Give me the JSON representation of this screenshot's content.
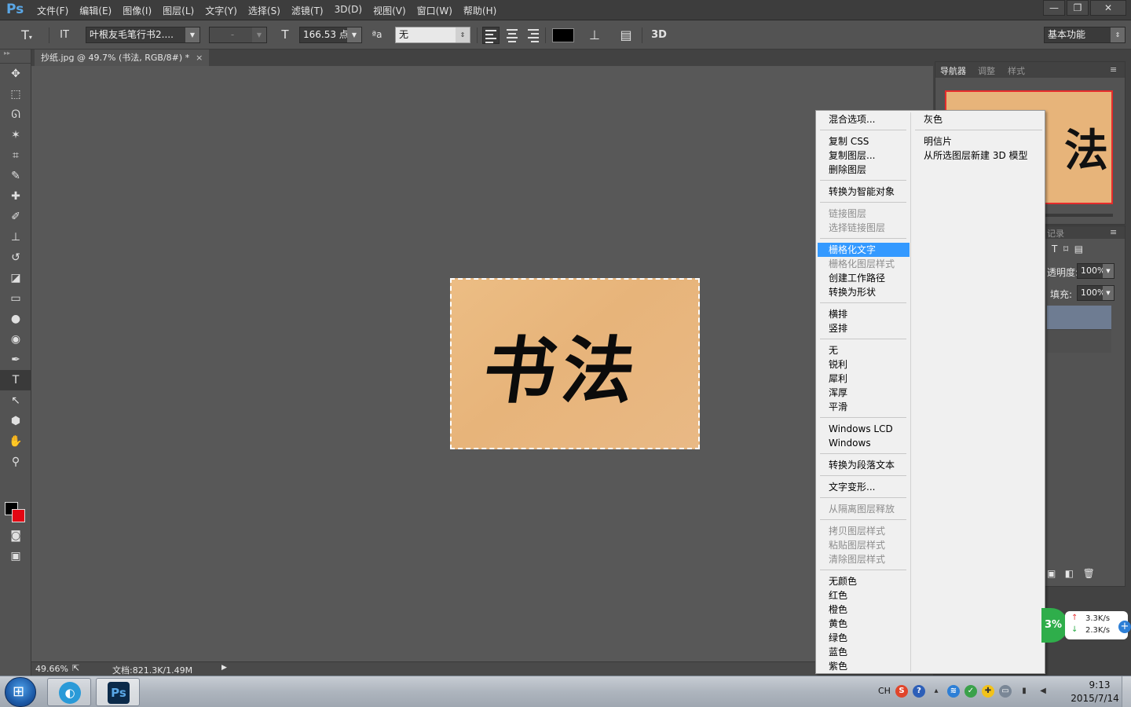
{
  "app": {
    "logo": "Ps",
    "menus": [
      "文件(F)",
      "编辑(E)",
      "图像(I)",
      "图层(L)",
      "文字(Y)",
      "选择(S)",
      "滤镜(T)",
      "3D(D)",
      "视图(V)",
      "窗口(W)",
      "帮助(H)"
    ],
    "window_controls": [
      "—",
      "❐",
      "✕"
    ]
  },
  "options_bar": {
    "tool_glyph": "T",
    "orient_glyph": "IT",
    "font_family": "叶根友毛笔行书2....",
    "font_style": "-",
    "size_glyph": "T",
    "font_size": "166.53 点",
    "aa_glyph": "ªa",
    "antialias": "无",
    "warp_glyph": "⊥",
    "panel_glyph": "▤",
    "threeD": "3D",
    "workspace": "基本功能",
    "text_color": "#000000"
  },
  "document": {
    "tab_title": "抄纸.jpg @ 49.7% (书法, RGB/8#) *",
    "tab_close": "×",
    "canvas_text": "书法"
  },
  "status": {
    "zoom": "49.66%",
    "doc_info": "文档:821.3K/1.49M",
    "arrow": "▶"
  },
  "panels": {
    "tabs": [
      "导航器",
      "调整",
      "样式"
    ],
    "thumb_text": "法",
    "layers_tab": "记录",
    "opacity_label": "透明度:",
    "opacity_value": "100%",
    "fill_label": "填充:",
    "fill_value": "100%"
  },
  "context_menu": {
    "col1": [
      {
        "label": "混合选项...",
        "state": "normal"
      },
      {
        "label": "复制 CSS",
        "state": "normal"
      },
      {
        "label": "复制图层...",
        "state": "normal"
      },
      {
        "label": "删除图层",
        "state": "normal"
      },
      {
        "label": "转换为智能对象",
        "state": "normal"
      },
      {
        "label": "链接图层",
        "state": "disabled"
      },
      {
        "label": "选择链接图层",
        "state": "disabled"
      },
      {
        "label": "栅格化文字",
        "state": "highlighted"
      },
      {
        "label": "栅格化图层样式",
        "state": "disabled"
      },
      {
        "label": "创建工作路径",
        "state": "normal"
      },
      {
        "label": "转换为形状",
        "state": "normal"
      },
      {
        "label": "横排",
        "state": "normal"
      },
      {
        "label": "竖排",
        "state": "normal"
      },
      {
        "label": "无",
        "state": "normal"
      },
      {
        "label": "锐利",
        "state": "normal"
      },
      {
        "label": "犀利",
        "state": "normal"
      },
      {
        "label": "浑厚",
        "state": "normal"
      },
      {
        "label": "平滑",
        "state": "normal"
      },
      {
        "label": "Windows LCD",
        "state": "normal"
      },
      {
        "label": "Windows",
        "state": "normal"
      },
      {
        "label": "转换为段落文本",
        "state": "normal"
      },
      {
        "label": "文字变形...",
        "state": "normal"
      },
      {
        "label": "从隔离图层释放",
        "state": "disabled"
      },
      {
        "label": "拷贝图层样式",
        "state": "disabled"
      },
      {
        "label": "粘贴图层样式",
        "state": "disabled"
      },
      {
        "label": "清除图层样式",
        "state": "disabled"
      },
      {
        "label": "无颜色",
        "state": "normal"
      },
      {
        "label": "红色",
        "state": "normal"
      },
      {
        "label": "橙色",
        "state": "normal"
      },
      {
        "label": "黄色",
        "state": "normal"
      },
      {
        "label": "绿色",
        "state": "normal"
      },
      {
        "label": "蓝色",
        "state": "normal"
      },
      {
        "label": "紫色",
        "state": "normal"
      }
    ],
    "col2": [
      "灰色",
      "明信片",
      "从所选图层新建 3D 模型"
    ]
  },
  "net_widget": {
    "percent": "3%",
    "upload": "3.3K/s",
    "download": "2.3K/s",
    "up_arrow": "↑",
    "down_arrow": "↓",
    "plus": "+"
  },
  "taskbar": {
    "ps_label": "Ps",
    "lang": "CH",
    "time": "9:13",
    "date": "2015/7/14"
  },
  "colors": {
    "foreground": "#000000",
    "background": "#e30613",
    "menu_highlight": "#3399ff",
    "accent": "#5aa7e6"
  }
}
